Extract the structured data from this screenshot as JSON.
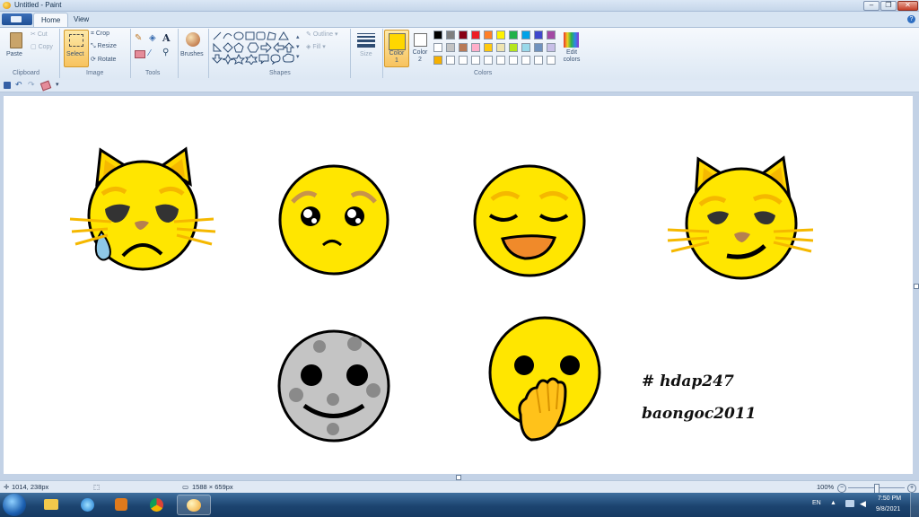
{
  "window": {
    "title": "Untitled - Paint"
  },
  "tabs": [
    {
      "label": "Home",
      "active": true
    },
    {
      "label": "View",
      "active": false
    }
  ],
  "ribbon": {
    "clipboard": {
      "paste": "Paste",
      "cut": "Cut",
      "copy": "Copy",
      "group": "Clipboard"
    },
    "image": {
      "select": "Select",
      "crop": "Crop",
      "resize": "Resize",
      "rotate": "Rotate",
      "group": "Image"
    },
    "tools": {
      "group": "Tools"
    },
    "brushes": {
      "label": "Brushes"
    },
    "shapes": {
      "outline": "Outline",
      "fill": "Fill",
      "group": "Shapes"
    },
    "size": {
      "label": "Size"
    },
    "colors": {
      "color1": "Color\n1",
      "color1_a": "Color",
      "color1_b": "1",
      "color2_a": "Color",
      "color2_b": "2",
      "edit_a": "Edit",
      "edit_b": "colors",
      "group": "Colors",
      "color1_value": "#ffd700",
      "palette_row1": [
        "#000000",
        "#7f7f7f",
        "#880015",
        "#ed1c24",
        "#ff7f27",
        "#fff200",
        "#22b14c",
        "#00a2e8",
        "#3f48cc",
        "#a349a4"
      ],
      "palette_row2": [
        "#ffffff",
        "#c3c3c3",
        "#b97a57",
        "#ffaec9",
        "#ffc90e",
        "#efe4b0",
        "#b5e61d",
        "#99d9ea",
        "#7092be",
        "#c8bfe7"
      ],
      "palette_row3": [
        "#f5b000",
        "#ffffff",
        "#ffffff",
        "#ffffff",
        "#ffffff",
        "#ffffff",
        "#ffffff",
        "#ffffff",
        "#ffffff",
        "#ffffff"
      ]
    }
  },
  "canvas": {
    "text1": "# hdap247",
    "text2": "baongoc2011"
  },
  "status": {
    "cursor": "1014, 238px",
    "canvas_size": "1588 × 659px",
    "zoom": "100%"
  },
  "taskbar": {
    "lang": "EN",
    "time": "7:50 PM",
    "date": "9/8/2021"
  }
}
